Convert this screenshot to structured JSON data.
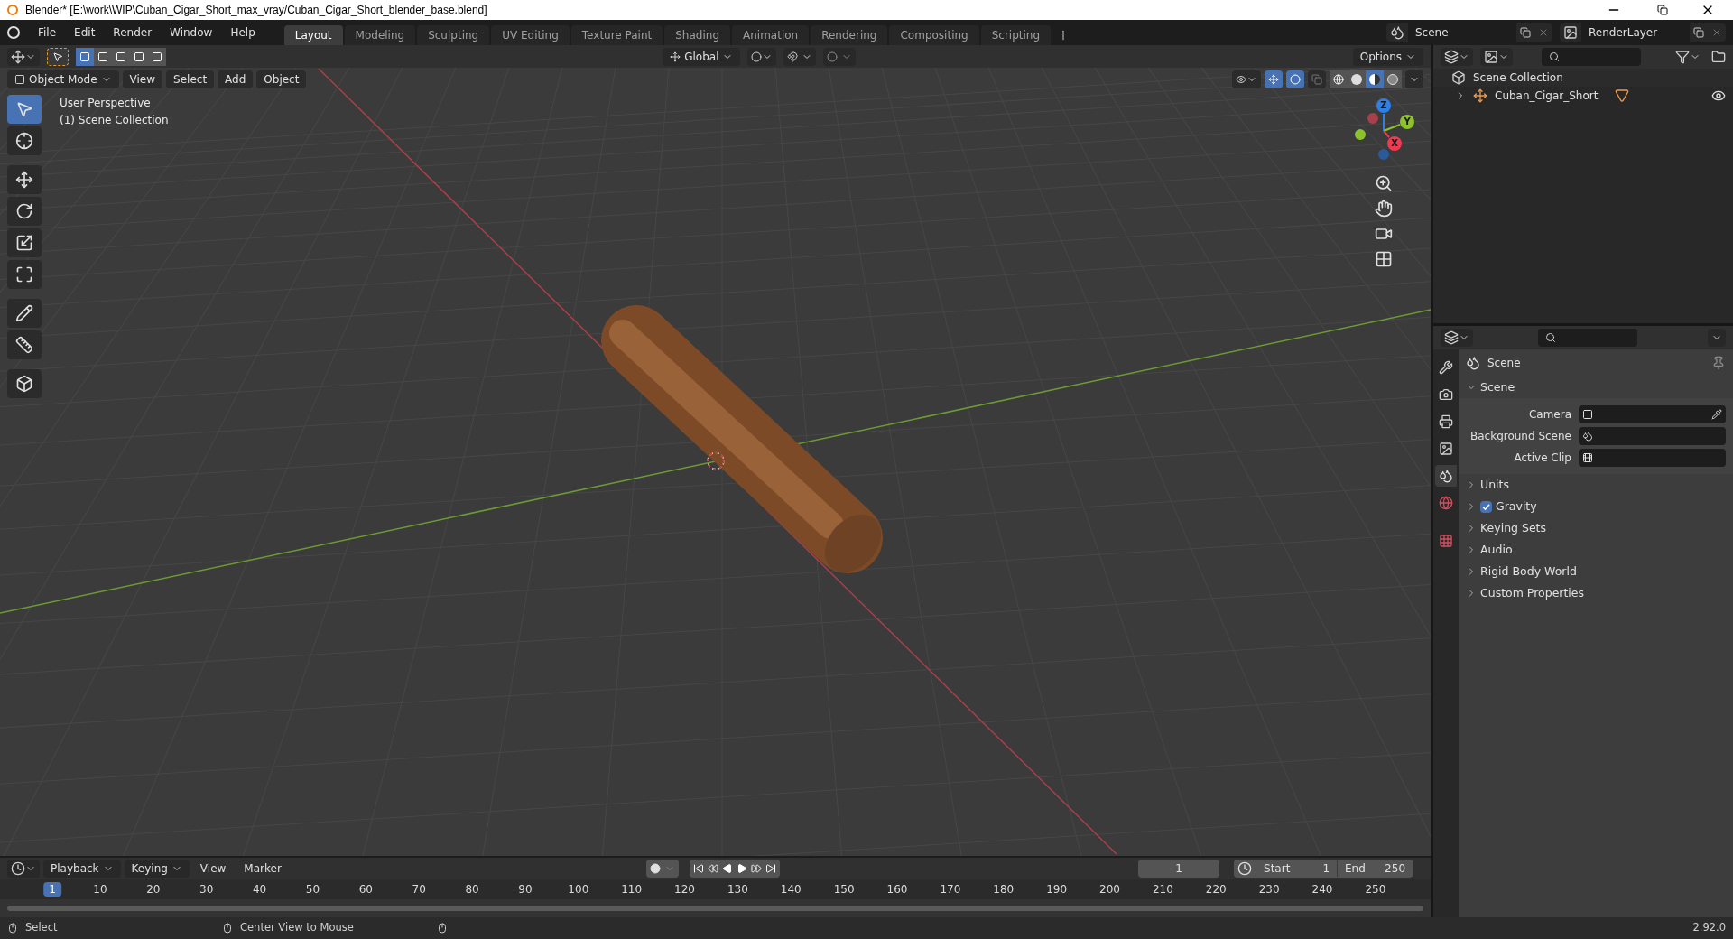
{
  "window": {
    "title": "Blender* [E:\\work\\WIP\\Cuban_Cigar_Short_max_vray/Cuban_Cigar_Short_blender_base.blend]"
  },
  "menu": [
    "File",
    "Edit",
    "Render",
    "Window",
    "Help"
  ],
  "workspaces": [
    {
      "label": "Layout",
      "selected": true
    },
    {
      "label": "Modeling",
      "selected": false
    },
    {
      "label": "Sculpting",
      "selected": false
    },
    {
      "label": "UV Editing",
      "selected": false
    },
    {
      "label": "Texture Paint",
      "selected": false
    },
    {
      "label": "Shading",
      "selected": false
    },
    {
      "label": "Animation",
      "selected": false
    },
    {
      "label": "Rendering",
      "selected": false
    },
    {
      "label": "Compositing",
      "selected": false
    },
    {
      "label": "Scripting",
      "selected": false
    }
  ],
  "scene_selector": {
    "value": "Scene"
  },
  "view_layer_selector": {
    "value": "RenderLayer"
  },
  "viewport": {
    "select_modes": [
      {
        "selected": true
      },
      {
        "selected": false
      },
      {
        "selected": false
      },
      {
        "selected": false
      },
      {
        "selected": false
      }
    ],
    "transform_orientation": "Global",
    "options": "Options",
    "mode": "Object Mode",
    "menus": [
      "View",
      "Select",
      "Add",
      "Object"
    ],
    "shading": [
      {
        "kind": "wireframe",
        "selected": false
      },
      {
        "kind": "solid",
        "selected": false
      },
      {
        "kind": "material",
        "selected": true
      },
      {
        "kind": "rendered",
        "selected": false
      }
    ],
    "overlay_text": [
      "User Perspective",
      "(1) Scene Collection"
    ],
    "tools": [
      {
        "kind": "select",
        "selected": true
      },
      {
        "kind": "cursor",
        "selected": false
      },
      {
        "kind": "move",
        "selected": false
      },
      {
        "kind": "rotate",
        "selected": false
      },
      {
        "kind": "scale",
        "selected": false
      },
      {
        "kind": "transform",
        "selected": false
      },
      {
        "kind": "annotate",
        "selected": false
      },
      {
        "kind": "measure",
        "selected": false
      },
      {
        "kind": "add_cube",
        "selected": false
      }
    ],
    "gizmo_axes": [
      {
        "label": "Z",
        "color": "#2e7fe6"
      },
      {
        "label": "Y",
        "color": "#8bc22d"
      },
      {
        "label": "X",
        "color": "#ee3b52"
      }
    ]
  },
  "outliner": {
    "items": [
      {
        "label": "Scene Collection",
        "children": [
          {
            "label": "Cuban_Cigar_Short",
            "expanded": false
          }
        ]
      }
    ]
  },
  "properties": {
    "tabs": [
      {
        "kind": "tool",
        "selected": false
      },
      {
        "kind": "render",
        "selected": false
      },
      {
        "kind": "output",
        "selected": false
      },
      {
        "kind": "view_layer",
        "selected": false
      },
      {
        "kind": "scene",
        "selected": true
      },
      {
        "kind": "world",
        "selected": false
      },
      {
        "kind": "texture",
        "selected": false
      }
    ],
    "context": "Scene",
    "panels": [
      {
        "label": "Scene",
        "expanded": true,
        "fields": [
          {
            "label": "Camera",
            "kind": "camera"
          },
          {
            "label": "Background Scene",
            "kind": "scene"
          },
          {
            "label": "Active Clip",
            "kind": "clip"
          }
        ]
      },
      {
        "label": "Units",
        "expanded": false
      },
      {
        "label": "Gravity",
        "expanded": false,
        "checked": true
      },
      {
        "label": "Keying Sets",
        "expanded": false
      },
      {
        "label": "Audio",
        "expanded": false
      },
      {
        "label": "Rigid Body World",
        "expanded": false
      },
      {
        "label": "Custom Properties",
        "expanded": false
      }
    ]
  },
  "timeline": {
    "menus": [
      "Playback",
      "Keying",
      "View",
      "Marker"
    ],
    "current_frame": "1",
    "start_label": "Start",
    "start": "1",
    "end_label": "End",
    "end": "250",
    "ticks": [
      "1",
      "10",
      "20",
      "30",
      "40",
      "50",
      "60",
      "70",
      "80",
      "90",
      "100",
      "110",
      "120",
      "130",
      "140",
      "150",
      "160",
      "170",
      "180",
      "190",
      "200",
      "210",
      "220",
      "230",
      "240",
      "250"
    ]
  },
  "status_bar": {
    "items": [
      "Select",
      "Center View to Mouse"
    ],
    "version": "2.92.0"
  }
}
